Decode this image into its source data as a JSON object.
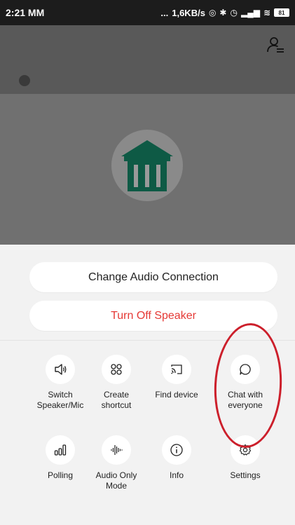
{
  "status_bar": {
    "time": "2:21 MM",
    "dots": "...",
    "network_speed": "1,6KB/s",
    "battery": "81"
  },
  "audio_options": {
    "change_audio_label": "Change Audio Connection",
    "turn_off_speaker_label": "Turn Off Speaker"
  },
  "actions": {
    "switch_speaker": "Switch\nSpeaker/Mic",
    "create_shortcut": "Create\nshortcut",
    "find_device": "Find device",
    "chat_everyone": "Chat with\neveryone",
    "polling": "Polling",
    "audio_only": "Audio Only\nMode",
    "info": "Info",
    "settings": "Settings"
  },
  "icons": [
    "profile-list-icon",
    "bank-icon",
    "speaker-icon",
    "grid-icon",
    "cast-icon",
    "chat-bubble-icon",
    "poll-icon",
    "waveform-icon",
    "info-icon",
    "gear-icon"
  ],
  "colors": {
    "accent_red": "#e53935",
    "avatar_green": "#0e5a45",
    "annotation_red": "#cc1f2b"
  }
}
